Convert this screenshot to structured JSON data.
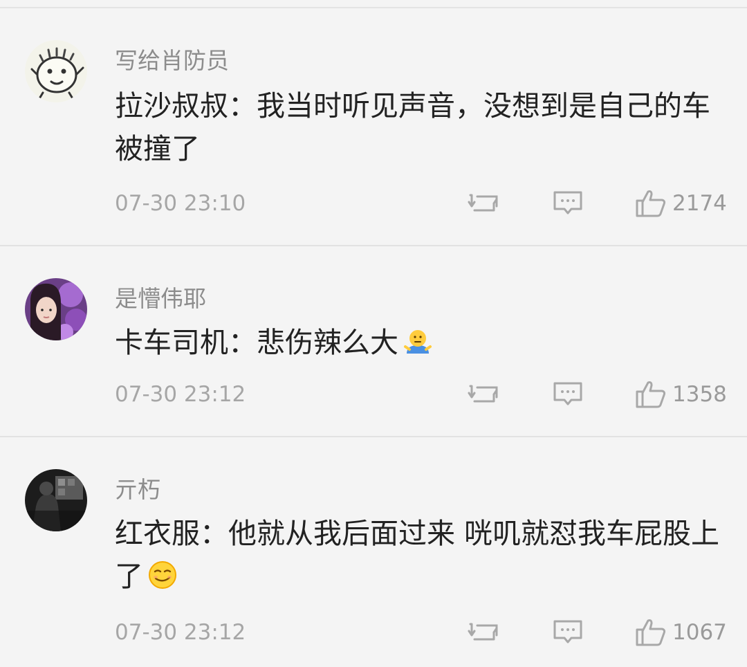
{
  "comments": [
    {
      "username": "写给肖防员",
      "text": "拉沙叔叔：我当时听见声音，没想到是自己的车被撞了",
      "timestamp": "07-30 23:10",
      "likes": "2174",
      "emoji": null,
      "avatar_icon": "doodle-face-avatar"
    },
    {
      "username": "是懵伟耶",
      "text": "卡车司机：悲伤辣么大",
      "timestamp": "07-30 23:12",
      "likes": "1358",
      "emoji": "shrug-emoji",
      "avatar_icon": "girl-photo-avatar"
    },
    {
      "username": "亓朽",
      "text": "红衣服：他就从我后面过来 咣叽就怼我车屁股上了",
      "timestamp": "07-30 23:12",
      "likes": "1067",
      "emoji": "smug-face-emoji",
      "avatar_icon": "dark-photo-avatar"
    }
  ],
  "icons": {
    "repost": "repost-icon",
    "reply": "comment-bubble-icon",
    "like": "thumbs-up-icon"
  },
  "colors": {
    "background": "#f4f4f4",
    "username": "#8c8c8c",
    "text": "#222222",
    "meta": "#a6a6a6"
  }
}
